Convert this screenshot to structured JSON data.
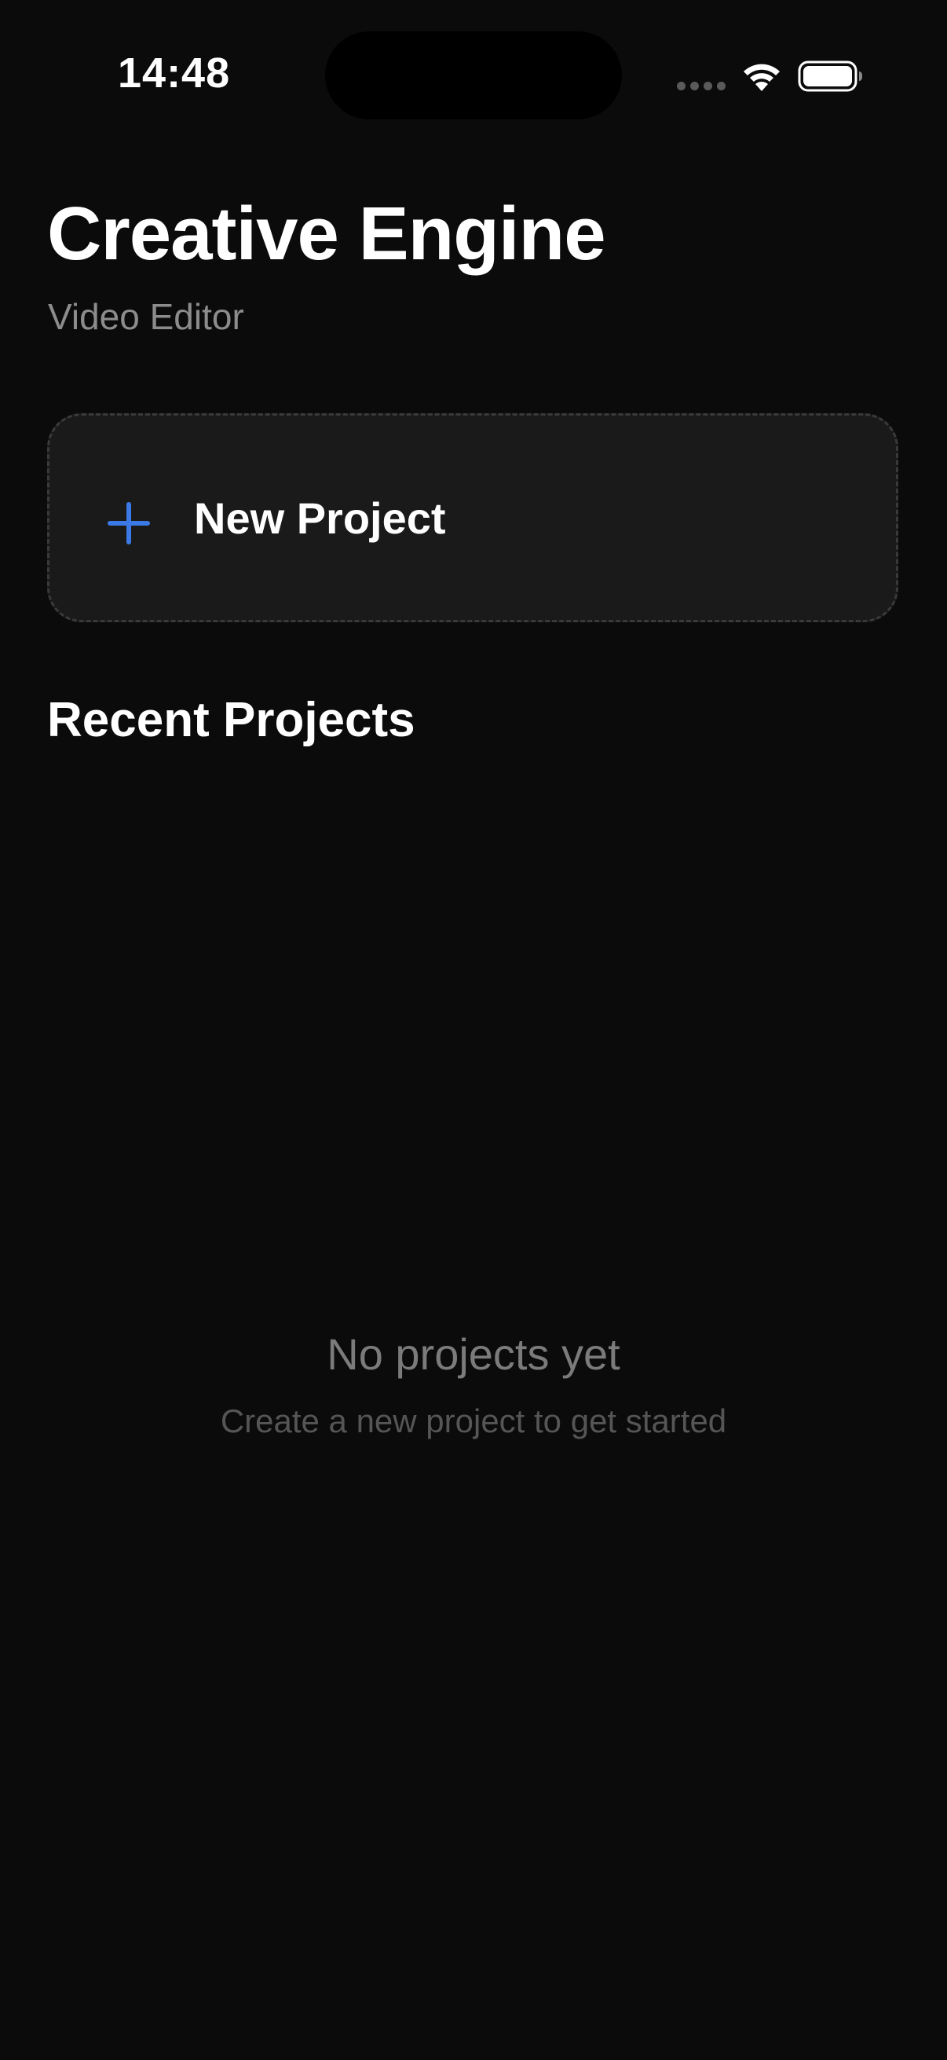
{
  "status_bar": {
    "time": "14:48",
    "icons": [
      "cellular-signal-icon",
      "wifi-icon",
      "battery-icon"
    ]
  },
  "header": {
    "title": "Creative Engine",
    "subtitle": "Video Editor"
  },
  "new_project": {
    "icon": "plus-icon",
    "label": "New Project",
    "accent_color": "#3b7ae6"
  },
  "recent_projects": {
    "title": "Recent Projects",
    "empty_title": "No projects yet",
    "empty_subtitle": "Create a new project to get started"
  }
}
